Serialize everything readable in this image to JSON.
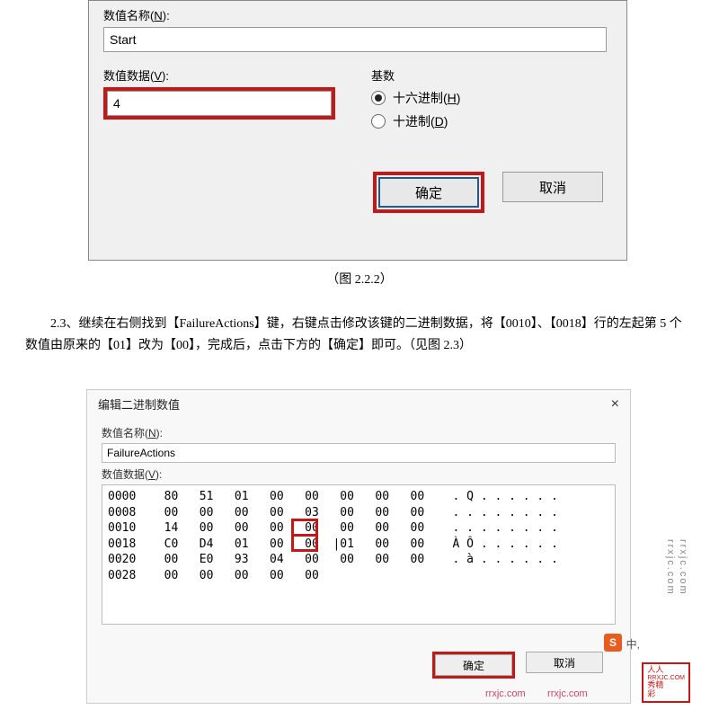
{
  "dialog1": {
    "name_label": "数值名称(N):",
    "name_value": "Start",
    "data_label": "数值数据(V):",
    "data_value": "4",
    "radix_label": "基数",
    "radix_hex": "十六进制(H)",
    "radix_dec": "十进制(D)",
    "ok": "确定",
    "cancel": "取消"
  },
  "caption1": "（图 2.2.2）",
  "article": {
    "p1": "　　2.3、继续在右侧找到【FailureActions】键，右键点击修改该键的二进制数据，将【0010】、【0018】行的左起第 5 个数值由原来的【01】改为【00】，完成后，点击下方的【确定】即可。（见图 2.3）"
  },
  "dialog2": {
    "title": "编辑二进制数值",
    "name_label": "数值名称(N):",
    "name_value": "FailureActions",
    "data_label": "数值数据(V):",
    "hex_rows": [
      "0000    80   51   01   00   00   00   00   00    . Q . . . . . .",
      "0008    00   00   00   00   03   00   00   00    . . . . . . . .",
      "0010    14   00   00   00   00   00   00   00    . . . . . . . .",
      "0018    C0   D4   01   00   00  |01   00   00    À Ô . . . . . .",
      "0020    00   E0   93   04   00   00   00   00    . à . . . . . .",
      "0028    00   00   00   00   00"
    ],
    "ok": "确定",
    "cancel": "取消"
  },
  "watermark": {
    "site": "rrxjc.com",
    "corner1": "人人",
    "corner2": "秀精",
    "corner3": "彩",
    "corner_url": "RRXJC.COM",
    "ime": "S",
    "ime_txt": "中,"
  }
}
